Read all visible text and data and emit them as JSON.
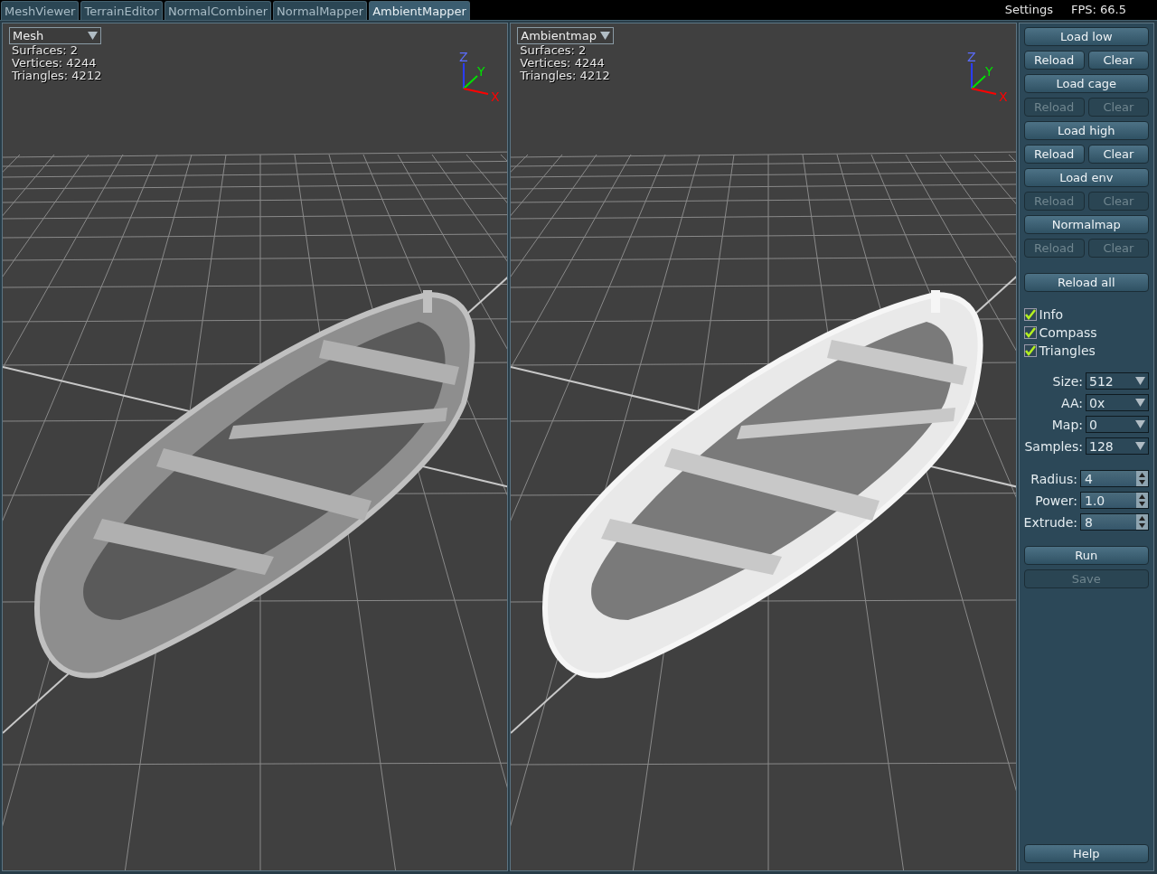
{
  "tabs": [
    {
      "label": "MeshViewer",
      "selected": false
    },
    {
      "label": "TerrainEditor",
      "selected": false
    },
    {
      "label": "NormalCombiner",
      "selected": false
    },
    {
      "label": "NormalMapper",
      "selected": false
    },
    {
      "label": "AmbientMapper",
      "selected": true
    }
  ],
  "status_bar": {
    "settings": "Settings",
    "fps": "FPS: 66.5"
  },
  "viewports": [
    {
      "dropdown": "Mesh",
      "textured": false,
      "stats": [
        "Surfaces: 2",
        "Vertices: 4244",
        "Triangles: 4212"
      ],
      "axes": {
        "z": "Z",
        "y": "Y",
        "x": "X"
      }
    },
    {
      "dropdown": "Ambientmap",
      "textured": true,
      "stats": [
        "Surfaces: 2",
        "Vertices: 4244",
        "Triangles: 4212"
      ],
      "axes": {
        "z": "Z",
        "y": "Y",
        "x": "X"
      }
    }
  ],
  "panel": {
    "button_rows": [
      {
        "kind": "single",
        "label": "Load low",
        "disabled": false
      },
      {
        "kind": "pair",
        "buttons": [
          {
            "label": "Reload",
            "disabled": false
          },
          {
            "label": "Clear",
            "disabled": false
          }
        ]
      },
      {
        "kind": "single",
        "label": "Load cage",
        "disabled": false
      },
      {
        "kind": "pair",
        "buttons": [
          {
            "label": "Reload",
            "disabled": true
          },
          {
            "label": "Clear",
            "disabled": true
          }
        ]
      },
      {
        "kind": "single",
        "label": "Load high",
        "disabled": false
      },
      {
        "kind": "pair",
        "buttons": [
          {
            "label": "Reload",
            "disabled": false
          },
          {
            "label": "Clear",
            "disabled": false
          }
        ]
      },
      {
        "kind": "single",
        "label": "Load env",
        "disabled": false
      },
      {
        "kind": "pair",
        "buttons": [
          {
            "label": "Reload",
            "disabled": true
          },
          {
            "label": "Clear",
            "disabled": true
          }
        ]
      },
      {
        "kind": "single",
        "label": "Normalmap",
        "disabled": false
      },
      {
        "kind": "pair",
        "buttons": [
          {
            "label": "Reload",
            "disabled": true
          },
          {
            "label": "Clear",
            "disabled": true
          }
        ]
      },
      {
        "kind": "spacer"
      },
      {
        "kind": "single",
        "label": "Reload all",
        "disabled": false
      }
    ],
    "checkboxes": [
      {
        "label": "Info",
        "checked": true
      },
      {
        "label": "Compass",
        "checked": true
      },
      {
        "label": "Triangles",
        "checked": true
      }
    ],
    "selects": [
      {
        "label": "Size:",
        "value": "512"
      },
      {
        "label": "AA:",
        "value": "0x"
      },
      {
        "label": "Map:",
        "value": "0"
      },
      {
        "label": "Samples:",
        "value": "128"
      }
    ],
    "spinners": [
      {
        "label": "Radius:",
        "value": "4"
      },
      {
        "label": "Power:",
        "value": "1.0"
      },
      {
        "label": "Extrude:",
        "value": "8"
      }
    ],
    "actions": [
      {
        "label": "Run",
        "disabled": false
      },
      {
        "label": "Save",
        "disabled": true
      }
    ],
    "help": "Help"
  }
}
